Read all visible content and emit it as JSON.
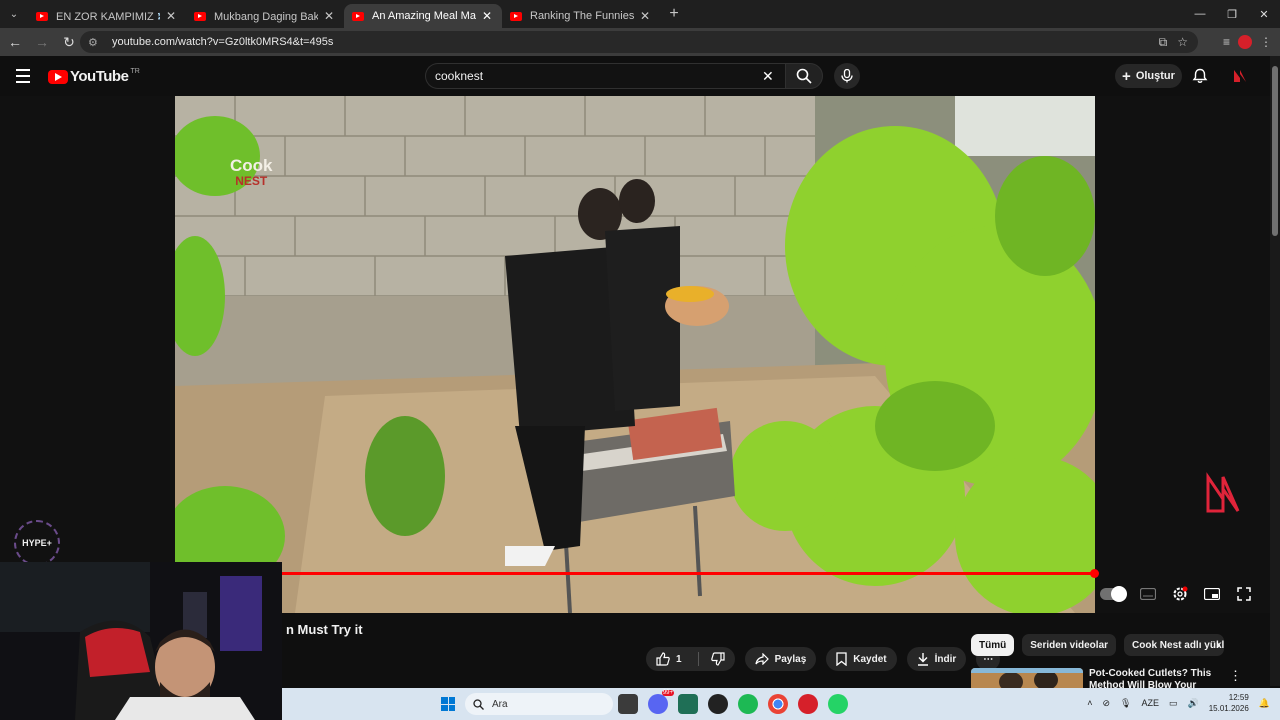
{
  "browser": {
    "tabs": [
      {
        "title": "EN ZOR KAMPIMIZ ❄️ KAR FIR",
        "active": false
      },
      {
        "title": "Mukbang Daging Bakar 😋 - Yo",
        "active": false
      },
      {
        "title": "An Amazing Meal Made Wi",
        "active": true
      },
      {
        "title": "Ranking The Funniest Parrot M",
        "active": false
      }
    ],
    "url": "youtube.com/watch?v=Gz0ltk0MRS4&t=495s"
  },
  "youtube": {
    "logo_text": "YouTube",
    "region": "TR",
    "search_value": "cooknest",
    "create_label": "Oluştur"
  },
  "video": {
    "channel_watermark_top": "Cook",
    "channel_watermark_bottom": "NEST",
    "hype_label": "HYPE+",
    "progress": 0.99,
    "title_visible": "n Must Try it"
  },
  "actions": {
    "like_count": "1",
    "share_label": "Paylaş",
    "save_label": "Kaydet",
    "download_label": "İndir"
  },
  "chips": [
    "Tümü",
    "Seriden videolar",
    "Cook Nest adlı yükley"
  ],
  "recommendation": {
    "title": "Pot-Cooked Cutlets? This Method Will Blow Your Mind!"
  },
  "taskbar": {
    "search_placeholder": "Ara",
    "language": "AZE",
    "time": "12:59",
    "date": "15.01.2026",
    "chat_badge": "99+"
  }
}
